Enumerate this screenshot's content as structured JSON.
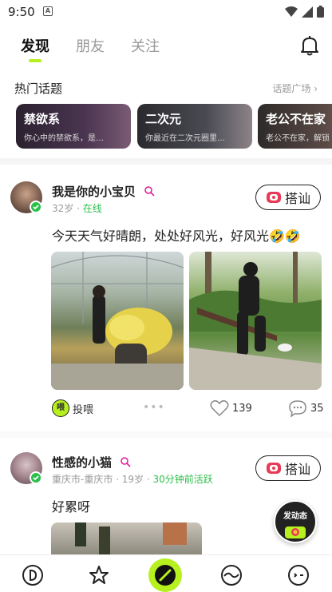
{
  "status": {
    "time": "9:50",
    "a_icon": "A"
  },
  "tabs": [
    {
      "label": "发现"
    },
    {
      "label": "朋友"
    },
    {
      "label": "关注"
    }
  ],
  "hot_topics": {
    "title": "热门话题",
    "more_link": "话题广场 ›",
    "items": [
      {
        "title": "禁欲系",
        "desc": "你心中的禁欲系，是…"
      },
      {
        "title": "二次元",
        "desc": "你最近在二次元圈里…"
      },
      {
        "title": "老公不在家",
        "desc": "老公不在家，解锁"
      }
    ]
  },
  "posts": [
    {
      "username": "我是你的小宝贝",
      "age": "32岁",
      "sep": "·",
      "status": "在线",
      "chat_label": "搭讪",
      "text": "今天天气好晴朗，处处好风光，好风光🤣🤣",
      "feed_label": "投喂",
      "feed_icon": "喂",
      "more": "•••",
      "likes": "139",
      "comments": "35"
    },
    {
      "username": "性感的小猫",
      "location": "重庆市-重庆市 · 19岁 ·",
      "status": "30分钟前活跃",
      "chat_label": "搭讪",
      "text": "好累呀"
    }
  ],
  "fab": {
    "label": "发动态"
  },
  "colors": {
    "accent": "#b6f01e",
    "online": "#2bbf4b"
  }
}
